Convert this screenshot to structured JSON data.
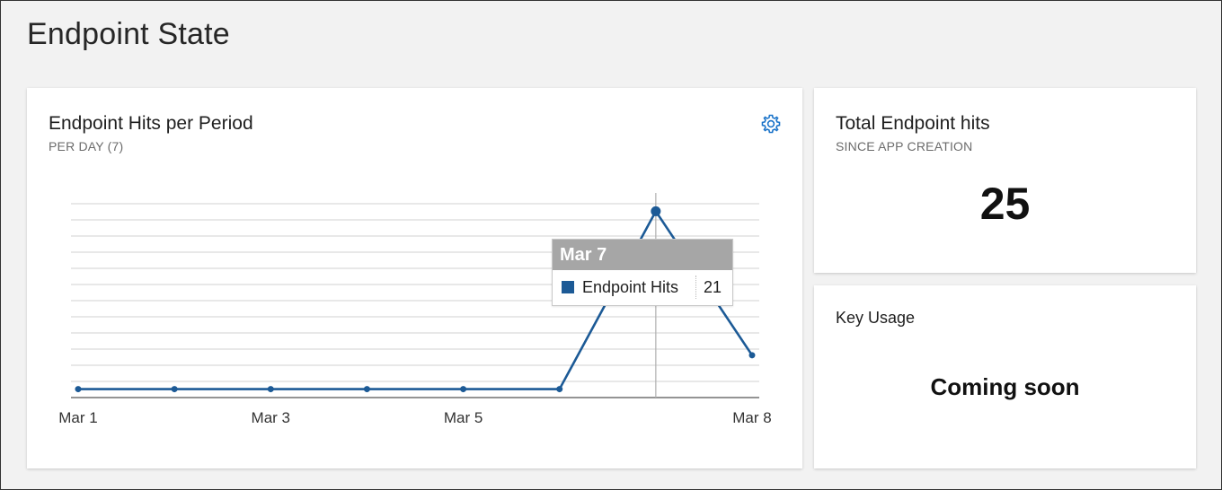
{
  "page": {
    "title": "Endpoint State"
  },
  "hits_card": {
    "title": "Endpoint Hits per Period",
    "subtitle": "PER DAY (7)",
    "settings_icon": "gear-icon"
  },
  "tooltip": {
    "date": "Mar 7",
    "series": "Endpoint Hits",
    "value": "21"
  },
  "total_card": {
    "title": "Total Endpoint hits",
    "subtitle": "SINCE APP CREATION",
    "value": "25"
  },
  "key_usage_card": {
    "title": "Key Usage",
    "status": "Coming soon"
  },
  "colors": {
    "accent": "#1c5a96",
    "gear": "#1a73c9",
    "grid": "#d9d9d9",
    "background": "#f2f2f2"
  },
  "chart_data": {
    "type": "line",
    "x": [
      "Mar 1",
      "Mar 2",
      "Mar 3",
      "Mar 4",
      "Mar 5",
      "Mar 6",
      "Mar 7",
      "Mar 8"
    ],
    "tick_labels": [
      "Mar 1",
      "Mar 3",
      "Mar 5",
      "Mar 8"
    ],
    "series": [
      {
        "name": "Endpoint Hits",
        "values": [
          0,
          0,
          0,
          0,
          0,
          0,
          21,
          4
        ]
      }
    ],
    "ylim": [
      -1,
      22
    ],
    "grid": true,
    "highlighted": "Mar 7"
  }
}
